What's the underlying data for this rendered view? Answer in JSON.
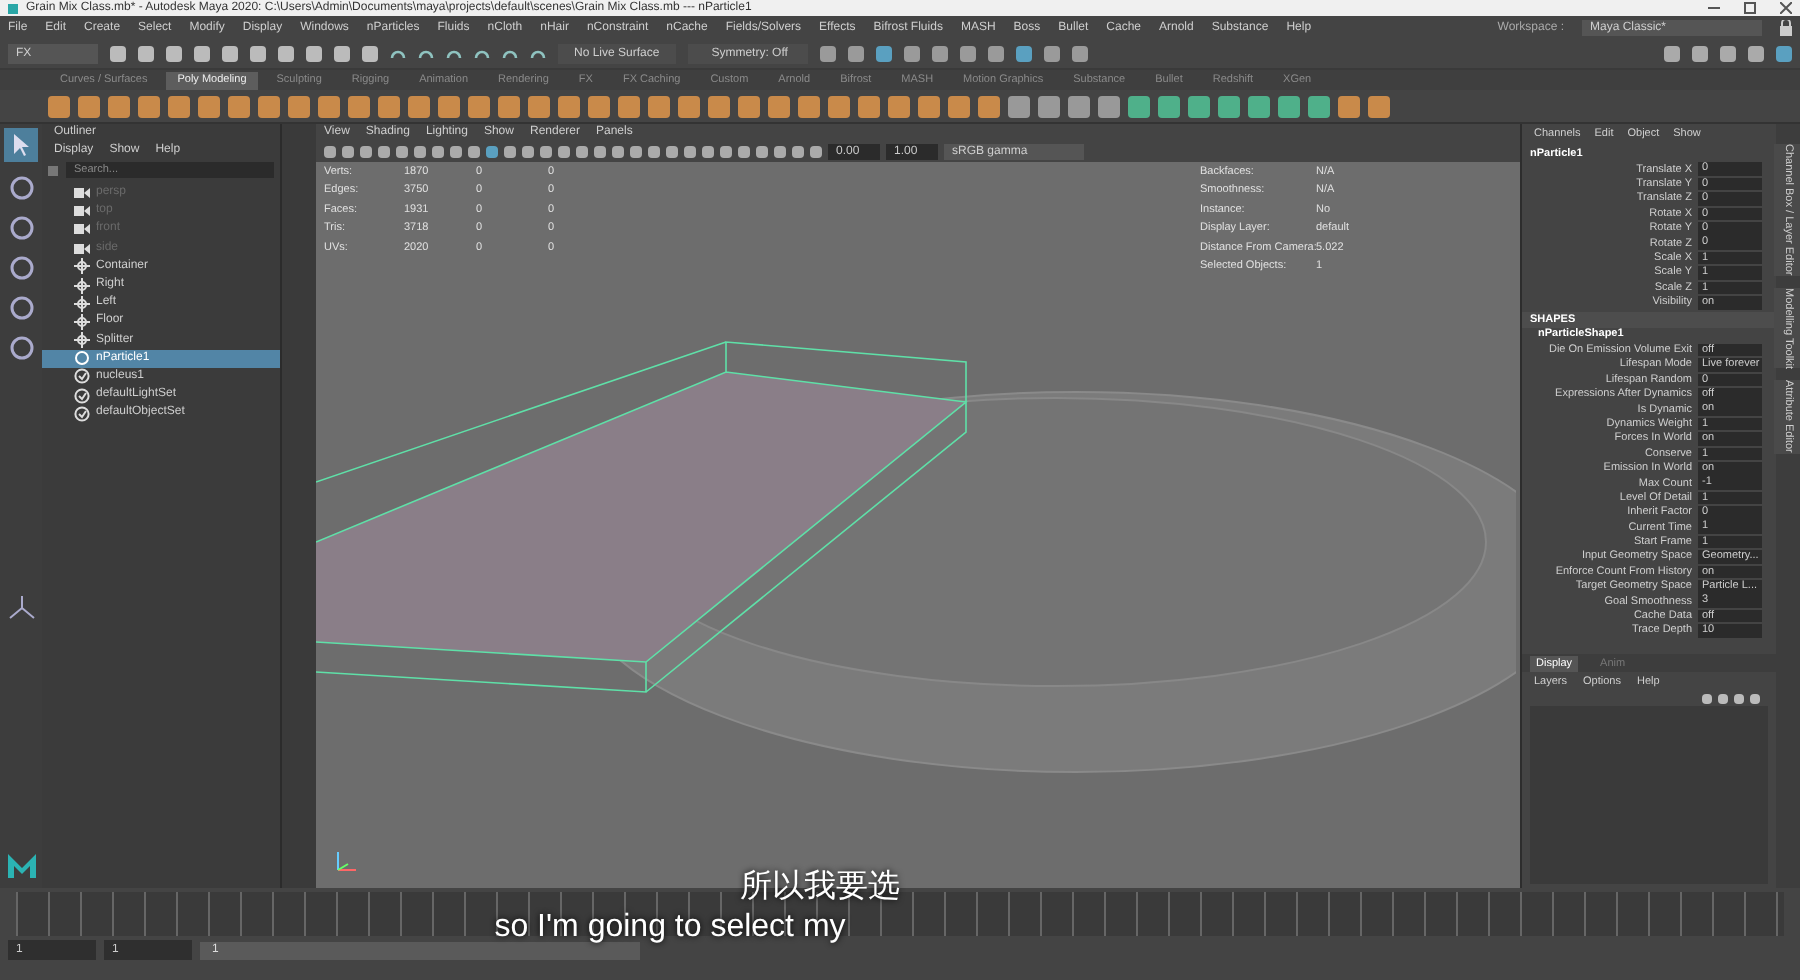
{
  "title_bar": {
    "title": "Grain Mix Class.mb* - Autodesk Maya 2020: C:\\Users\\Admin\\Documents\\maya\\projects\\default\\scenes\\Grain Mix Class.mb  ---  nParticle1"
  },
  "menu_bar": {
    "items": [
      "File",
      "Edit",
      "Create",
      "Select",
      "Modify",
      "Display",
      "Windows",
      "nParticles",
      "Fluids",
      "nCloth",
      "nHair",
      "nConstraint",
      "nCache",
      "Fields/Solvers",
      "Effects",
      "Bifrost Fluids",
      "MASH",
      "Boss",
      "Bullet",
      "Cache",
      "Arnold",
      "Substance",
      "Help"
    ],
    "workspace_label": "Workspace :",
    "workspace": "Maya Classic*"
  },
  "status_line": {
    "mode": "FX",
    "live_surface": "No Live Surface",
    "symmetry": "Symmetry: Off"
  },
  "shelf_tabs": [
    {
      "label": "Curves / Surfaces",
      "selected": false
    },
    {
      "label": "Poly Modeling",
      "selected": true
    },
    {
      "label": "Sculpting",
      "selected": false
    },
    {
      "label": "Rigging",
      "selected": false
    },
    {
      "label": "Animation",
      "selected": false
    },
    {
      "label": "Rendering",
      "selected": false
    },
    {
      "label": "FX",
      "selected": false
    },
    {
      "label": "FX Caching",
      "selected": false
    },
    {
      "label": "Custom",
      "selected": false
    },
    {
      "label": "Arnold",
      "selected": false
    },
    {
      "label": "Bifrost",
      "selected": false
    },
    {
      "label": "MASH",
      "selected": false
    },
    {
      "label": "Motion Graphics",
      "selected": false
    },
    {
      "label": "Substance",
      "selected": false
    },
    {
      "label": "Bullet",
      "selected": false
    },
    {
      "label": "Redshift",
      "selected": false
    },
    {
      "label": "XGen",
      "selected": false
    }
  ],
  "outliner": {
    "title": "Outliner",
    "menus": [
      "Display",
      "Show",
      "Help"
    ],
    "search_placeholder": "Search...",
    "items": [
      {
        "label": "persp",
        "kind": "camera",
        "dimmed": true,
        "selected": false
      },
      {
        "label": "top",
        "kind": "camera",
        "dimmed": true,
        "selected": false
      },
      {
        "label": "front",
        "kind": "camera",
        "dimmed": true,
        "selected": false
      },
      {
        "label": "side",
        "kind": "camera",
        "dimmed": true,
        "selected": false
      },
      {
        "label": "Container",
        "kind": "transform",
        "dimmed": false,
        "selected": false
      },
      {
        "label": "Right",
        "kind": "transform",
        "dimmed": false,
        "selected": false
      },
      {
        "label": "Left",
        "kind": "transform",
        "dimmed": false,
        "selected": false
      },
      {
        "label": "Floor",
        "kind": "transform",
        "dimmed": false,
        "selected": false
      },
      {
        "label": "Splitter",
        "kind": "transform",
        "dimmed": false,
        "selected": false
      },
      {
        "label": "nParticle1",
        "kind": "particle",
        "dimmed": false,
        "selected": true
      },
      {
        "label": "nucleus1",
        "kind": "set",
        "dimmed": false,
        "selected": false
      },
      {
        "label": "defaultLightSet",
        "kind": "set",
        "dimmed": false,
        "selected": false
      },
      {
        "label": "defaultObjectSet",
        "kind": "set",
        "dimmed": false,
        "selected": false
      }
    ]
  },
  "viewport": {
    "menus": [
      "View",
      "Shading",
      "Lighting",
      "Show",
      "Renderer",
      "Panels"
    ],
    "exposure": "0.00",
    "gamma": "1.00",
    "color_space": "sRGB gamma",
    "hud_left": [
      {
        "label": "Verts:",
        "values": [
          "1870",
          "0",
          "0"
        ]
      },
      {
        "label": "Edges:",
        "values": [
          "3750",
          "0",
          "0"
        ]
      },
      {
        "label": "Faces:",
        "values": [
          "1931",
          "0",
          "0"
        ]
      },
      {
        "label": "Tris:",
        "values": [
          "3718",
          "0",
          "0"
        ]
      },
      {
        "label": "UVs:",
        "values": [
          "2020",
          "0",
          "0"
        ]
      }
    ],
    "hud_right": [
      {
        "label": "Backfaces:",
        "value": "N/A"
      },
      {
        "label": "Smoothness:",
        "value": "N/A"
      },
      {
        "label": "Instance:",
        "value": "No"
      },
      {
        "label": "Display Layer:",
        "value": "default"
      },
      {
        "label": "Distance From Camera:",
        "value": "5.022"
      },
      {
        "label": "Selected Objects:",
        "value": "1"
      }
    ]
  },
  "subtitles": [
    "所以我要选",
    "so I'm going to select my"
  ],
  "channel_box": {
    "menus": [
      "Channels",
      "Edit",
      "Object",
      "Show"
    ],
    "object": "nParticle1",
    "channels": [
      {
        "label": "Translate X",
        "value": "0"
      },
      {
        "label": "Translate Y",
        "value": "0"
      },
      {
        "label": "Translate Z",
        "value": "0"
      },
      {
        "label": "Rotate X",
        "value": "0"
      },
      {
        "label": "Rotate Y",
        "value": "0"
      },
      {
        "label": "Rotate Z",
        "value": "0"
      },
      {
        "label": "Scale X",
        "value": "1"
      },
      {
        "label": "Scale Y",
        "value": "1"
      },
      {
        "label": "Scale Z",
        "value": "1"
      },
      {
        "label": "Visibility",
        "value": "on"
      }
    ],
    "shapes_header": "SHAPES",
    "shape": "nParticleShape1",
    "shape_channels": [
      {
        "label": "Die On Emission Volume Exit",
        "value": "off"
      },
      {
        "label": "Lifespan Mode",
        "value": "Live forever"
      },
      {
        "label": "Lifespan Random",
        "value": "0"
      },
      {
        "label": "Expressions After Dynamics",
        "value": "off"
      },
      {
        "label": "Is Dynamic",
        "value": "on"
      },
      {
        "label": "Dynamics Weight",
        "value": "1"
      },
      {
        "label": "Forces In World",
        "value": "on"
      },
      {
        "label": "Conserve",
        "value": "1"
      },
      {
        "label": "Emission In World",
        "value": "on"
      },
      {
        "label": "Max Count",
        "value": "-1"
      },
      {
        "label": "Level Of Detail",
        "value": "1"
      },
      {
        "label": "Inherit Factor",
        "value": "0"
      },
      {
        "label": "Current Time",
        "value": "1"
      },
      {
        "label": "Start Frame",
        "value": "1"
      },
      {
        "label": "Input Geometry Space",
        "value": "Geometry..."
      },
      {
        "label": "Enforce Count From History",
        "value": "on"
      },
      {
        "label": "Target Geometry Space",
        "value": "Particle L..."
      },
      {
        "label": "Goal Smoothness",
        "value": "3"
      },
      {
        "label": "Cache Data",
        "value": "off"
      },
      {
        "label": "Trace Depth",
        "value": "10"
      }
    ]
  },
  "layer_editor": {
    "tabs": [
      {
        "label": "Display",
        "selected": true
      },
      {
        "label": "Anim",
        "selected": false
      }
    ],
    "menus": [
      "Layers",
      "Options",
      "Help"
    ]
  },
  "side_tabs": [
    "Channel Box / Layer Editor",
    "Modelling Toolkit",
    "Attribute Editor"
  ],
  "range": {
    "start": "1",
    "playback_start": "1",
    "slider_start": "1"
  }
}
